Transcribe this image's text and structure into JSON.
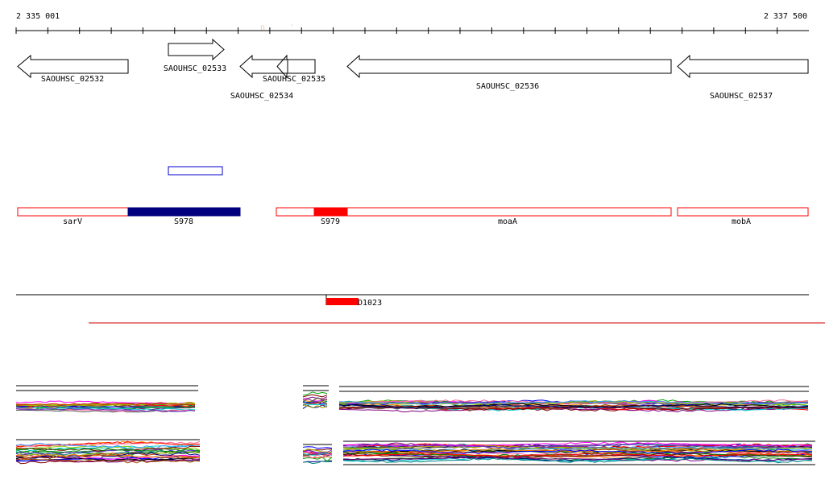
{
  "axis": {
    "start_label": "2 335 001",
    "end_label": "2 337 500",
    "start": 2335001,
    "end": 2337500
  },
  "genes": [
    {
      "id": "gene-02532",
      "label": "SAOUHSC_02532",
      "strand": "-"
    },
    {
      "id": "gene-02533",
      "label": "SAOUHSC_02533",
      "strand": "+"
    },
    {
      "id": "gene-02534",
      "label": "SAOUHSC_02534",
      "strand": "-"
    },
    {
      "id": "gene-02535",
      "label": "SAOUHSC_02535",
      "strand": "-"
    },
    {
      "id": "gene-02536",
      "label": "SAOUHSC_02536",
      "strand": "-"
    },
    {
      "id": "gene-02537",
      "label": "SAOUHSC_02537",
      "strand": "-"
    }
  ],
  "features": [
    {
      "id": "sarV",
      "label": "sarV",
      "style": "outline-red"
    },
    {
      "id": "S978",
      "label": "S978",
      "style": "filled-navy"
    },
    {
      "id": "S979",
      "label": "S979",
      "style": "filled-red"
    },
    {
      "id": "moaA",
      "label": "moaA",
      "style": "outline-red"
    },
    {
      "id": "mobA",
      "label": "mobA",
      "style": "outline-red"
    }
  ],
  "small_feature": {
    "label": "",
    "style": "outline-blue"
  },
  "track_feature": {
    "label": "D1023",
    "style": "filled-red"
  },
  "colors": {
    "gene_stroke": "#000000",
    "red": "#ff0000",
    "navy": "#00007f",
    "blue": "#0000cc",
    "threshold_line": "#cc0000"
  }
}
